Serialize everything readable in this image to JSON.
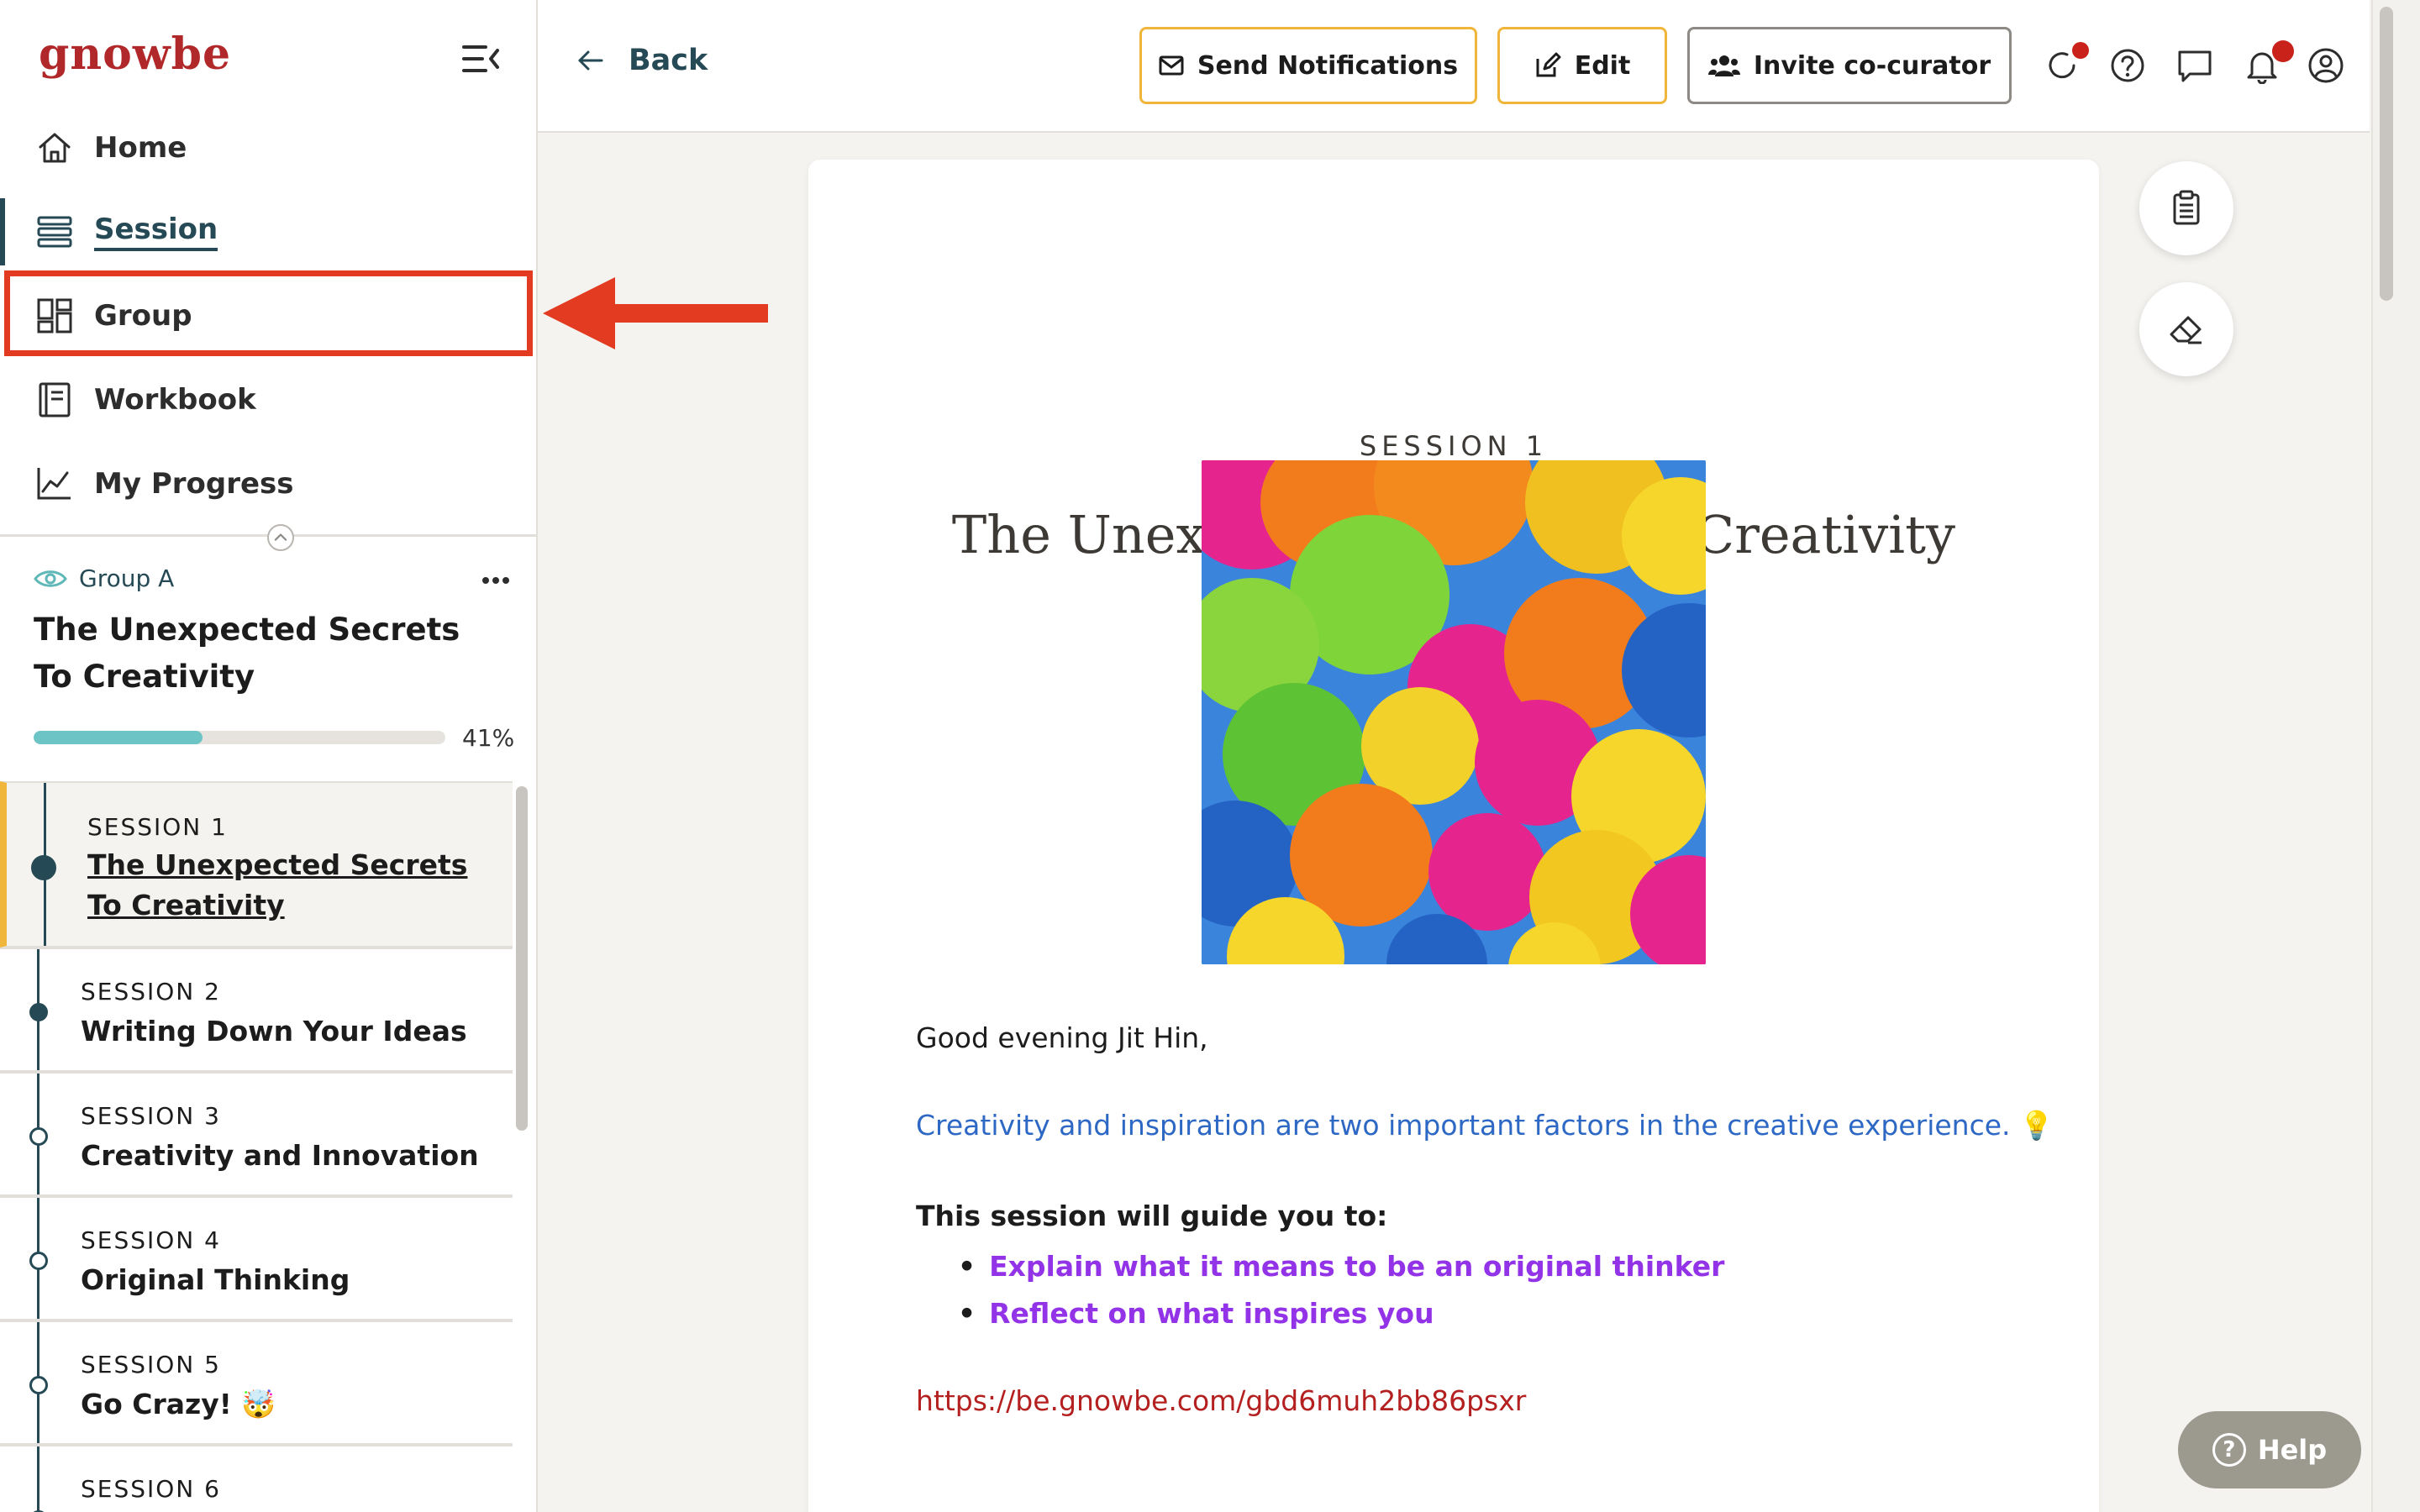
{
  "app": {
    "logo_text": "gnowbe",
    "brand_color": "#b1282a",
    "accent_color": "#264a55"
  },
  "sidebar": {
    "nav": [
      {
        "label": "Home",
        "icon": "home-icon"
      },
      {
        "label": "Session",
        "icon": "session-list-icon",
        "active": true
      },
      {
        "label": "Group",
        "icon": "group-dashboard-icon",
        "highlighted": true
      },
      {
        "label": "Workbook",
        "icon": "workbook-icon"
      },
      {
        "label": "My Progress",
        "icon": "progress-chart-icon"
      }
    ],
    "group_name": "Group A",
    "course_title": "The Unexpected Secrets To Creativity",
    "progress": {
      "percent": 41,
      "label": "41%"
    },
    "sessions": [
      {
        "num": "SESSION 1",
        "title": "The Unexpected Secrets To Creativity",
        "current": true
      },
      {
        "num": "SESSION 2",
        "title": "Writing Down Your Ideas"
      },
      {
        "num": "SESSION 3",
        "title": "Creativity and Innovation"
      },
      {
        "num": "SESSION 4",
        "title": "Original Thinking"
      },
      {
        "num": "SESSION 5",
        "title": "Go Crazy! 🤯"
      },
      {
        "num": "SESSION 6",
        "title": ""
      }
    ]
  },
  "topbar": {
    "back_label": "Back",
    "send_notifications_label": "Send Notifications",
    "edit_label": "Edit",
    "invite_label": "Invite co-curator"
  },
  "content": {
    "session_num": "SESSION 1",
    "title": "The Unexpected Secrets To Creativity",
    "greeting": "Good evening Jit Hin,",
    "intro": "Creativity and inspiration are two important factors in the creative experience. 💡",
    "guide_heading": "This session will guide you to:",
    "bullets": [
      "Explain what it means to be an original thinker",
      "Reflect on what inspires you"
    ],
    "link": "https://be.gnowbe.com/gbd6muh2bb86psxr"
  },
  "help_label": "Help"
}
